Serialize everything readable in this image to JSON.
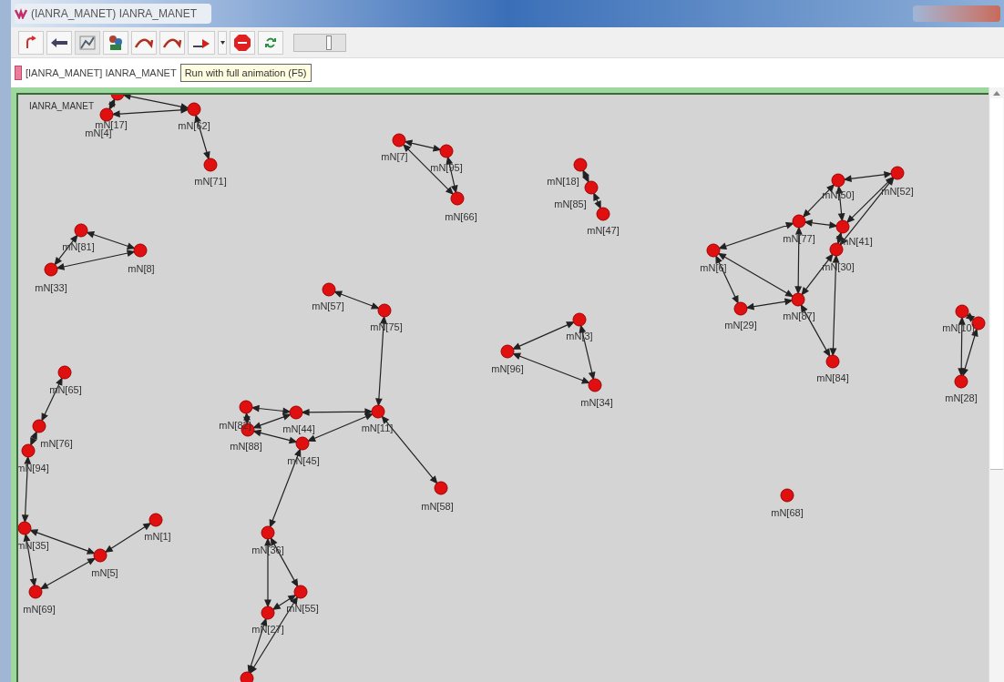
{
  "window": {
    "title": "(IANRA_MANET) IANRA_MANET"
  },
  "toolbar": {
    "speed_slider": {
      "level": 0.7
    }
  },
  "path_bar": {
    "text": "[IANRA_MANET] IANRA_MANET",
    "tooltip": "Run with full animation (F5)"
  },
  "canvas": {
    "title": "IANRA_MANET",
    "nodes": [
      {
        "label": "mN[17]"
      },
      {
        "label": "mN[4]"
      },
      {
        "label": "mN[62]"
      },
      {
        "label": "mN[7]"
      },
      {
        "label": "mN[95]"
      },
      {
        "label": "mN[71]"
      },
      {
        "label": "mN[18]"
      },
      {
        "label": "mN[85]"
      },
      {
        "label": "mN[50]"
      },
      {
        "label": "mN[52]"
      },
      {
        "label": "mN[66]"
      },
      {
        "label": "mN[47]"
      },
      {
        "label": "mN[81]"
      },
      {
        "label": "mN[77]"
      },
      {
        "label": "mN[41]"
      },
      {
        "label": "mN[8]"
      },
      {
        "label": "mN[6]"
      },
      {
        "label": "mN[30]"
      },
      {
        "label": "mN[33]"
      },
      {
        "label": "mN[57]"
      },
      {
        "label": "mN[87]"
      },
      {
        "label": "mN[75]"
      },
      {
        "label": "mN[3]"
      },
      {
        "label": "mN[29]"
      },
      {
        "label": "mN[10]"
      },
      {
        "label": "mN[96]"
      },
      {
        "label": "mN[84]"
      },
      {
        "label": "mN[65]"
      },
      {
        "label": "mN[34]"
      },
      {
        "label": "mN[28]"
      },
      {
        "label": "mN[82]"
      },
      {
        "label": "mN[44]"
      },
      {
        "label": "mN[11]"
      },
      {
        "label": "mN[76]"
      },
      {
        "label": "mN[88]"
      },
      {
        "label": "mN[94]"
      },
      {
        "label": "mN[45]"
      },
      {
        "label": "mN[58]"
      },
      {
        "label": "mN[68]"
      },
      {
        "label": "mN[35]"
      },
      {
        "label": "mN[1]"
      },
      {
        "label": "mN[36]"
      },
      {
        "label": "mN[5]"
      },
      {
        "label": "mN[69]"
      },
      {
        "label": "mN[55]"
      },
      {
        "label": "mN[27]"
      }
    ]
  }
}
